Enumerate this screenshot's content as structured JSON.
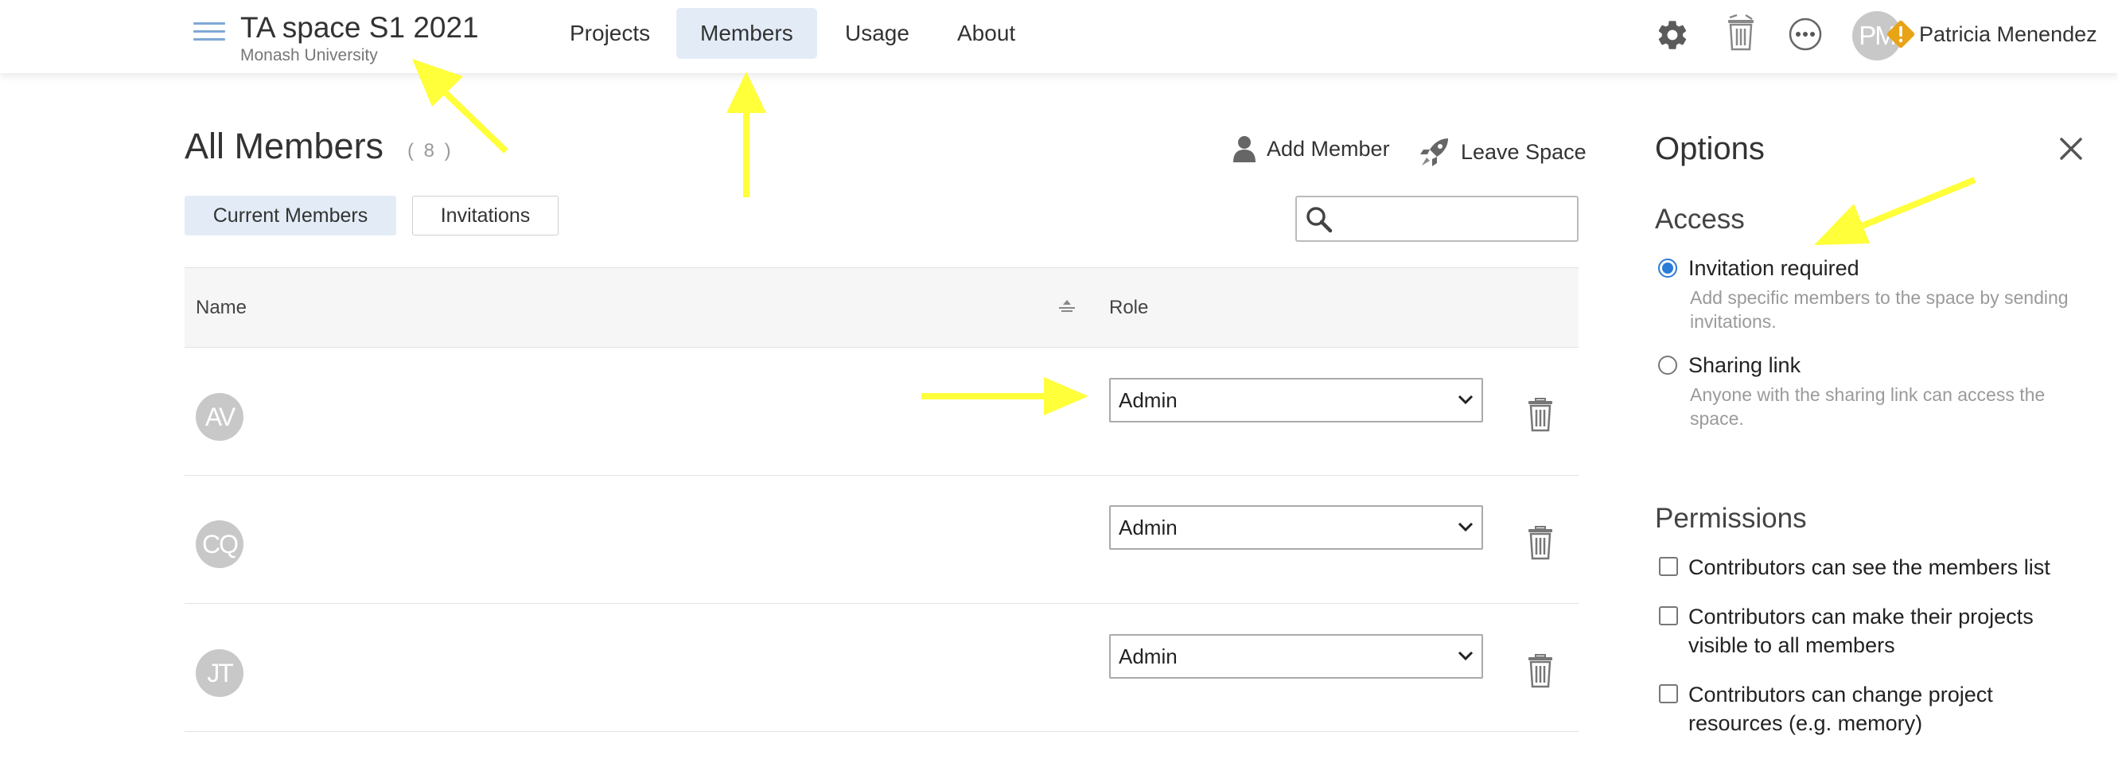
{
  "header": {
    "space_title": "TA space S1 2021",
    "space_subtitle": "Monash University",
    "nav": [
      {
        "label": "Projects",
        "active": false
      },
      {
        "label": "Members",
        "active": true
      },
      {
        "label": "Usage",
        "active": false
      },
      {
        "label": "About",
        "active": false
      }
    ],
    "icons": [
      "menu-icon",
      "gear-icon",
      "trash-icon",
      "more-icon",
      "warning-icon"
    ],
    "user": {
      "initials": "PM",
      "name": "Patricia Menendez"
    }
  },
  "main": {
    "title": "All Members",
    "count": "( 8 )",
    "add_member_label": "Add Member",
    "leave_space_label": "Leave Space",
    "tabs": [
      {
        "label": "Current Members",
        "active": true
      },
      {
        "label": "Invitations",
        "active": false
      }
    ],
    "search": {
      "placeholder": "",
      "value": ""
    },
    "table": {
      "columns": [
        "Name",
        "Role"
      ],
      "rows": [
        {
          "initials": "AV",
          "role": "Admin"
        },
        {
          "initials": "CQ",
          "role": "Admin"
        },
        {
          "initials": "JT",
          "role": "Admin"
        }
      ],
      "role_options": [
        "Admin"
      ]
    }
  },
  "options": {
    "title": "Options",
    "access": {
      "heading": "Access",
      "choices": [
        {
          "label": "Invitation required",
          "desc": "Add specific members to the space by sending invitations.",
          "checked": true
        },
        {
          "label": "Sharing link",
          "desc": "Anyone with the sharing link can access the space.",
          "checked": false
        }
      ]
    },
    "permissions": {
      "heading": "Permissions",
      "items": [
        {
          "label": "Contributors can see the members list",
          "checked": false
        },
        {
          "label": "Contributors can make their projects visible to all members",
          "checked": false
        },
        {
          "label": "Contributors can change project resources (e.g. memory)",
          "checked": false
        }
      ]
    }
  },
  "colors": {
    "accent": "#2b7bd9",
    "active_tab_bg": "#e3ecf6",
    "avatar_bg": "#c8c8c8",
    "warning": "#e8a317",
    "annotation_arrow": "#ffff3a"
  }
}
